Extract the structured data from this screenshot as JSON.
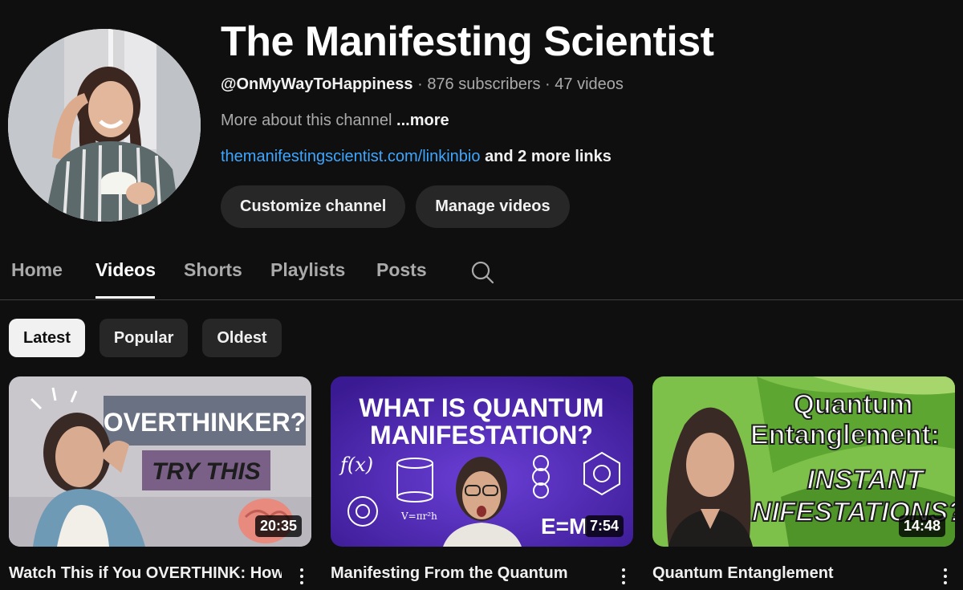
{
  "channel": {
    "title": "The Manifesting Scientist",
    "handle": "@OnMyWayToHappiness",
    "subscribers": "876 subscribers",
    "videos": "47 videos",
    "separator": " · ",
    "about": "More about this channel",
    "more_label": "...more",
    "link": "themanifestingscientist.com/linkinbio",
    "extra_links": "and 2 more links"
  },
  "actions": {
    "customize_label": "Customize channel",
    "manage_label": "Manage videos"
  },
  "tabs": [
    {
      "label": "Home"
    },
    {
      "label": "Videos",
      "active": true
    },
    {
      "label": "Shorts"
    },
    {
      "label": "Playlists"
    },
    {
      "label": "Posts"
    }
  ],
  "chips": [
    {
      "label": "Latest",
      "selected": true
    },
    {
      "label": "Popular"
    },
    {
      "label": "Oldest"
    }
  ],
  "videos": [
    {
      "title": "Watch This if You OVERTHINK: How",
      "duration": "20:35",
      "thumb_text": [
        "OVERTHINKER?",
        "TRY THIS"
      ]
    },
    {
      "title": "Manifesting From the Quantum",
      "duration": "7:54",
      "thumb_text": [
        "WHAT IS QUANTUM",
        "MANIFESTATION?",
        "f(x)",
        "E=M",
        "V=πr²h"
      ]
    },
    {
      "title": "Quantum Entanglement",
      "duration": "14:48",
      "thumb_text": [
        "Quantum",
        "Entanglement:",
        "INSTANT",
        "MANIFESTATIONS?"
      ]
    }
  ],
  "icons": {
    "search": "search-icon",
    "more": "more-vert-icon"
  },
  "colors": {
    "background": "#0f0f0f",
    "link": "#3ea6ff",
    "chip": "#272727"
  }
}
